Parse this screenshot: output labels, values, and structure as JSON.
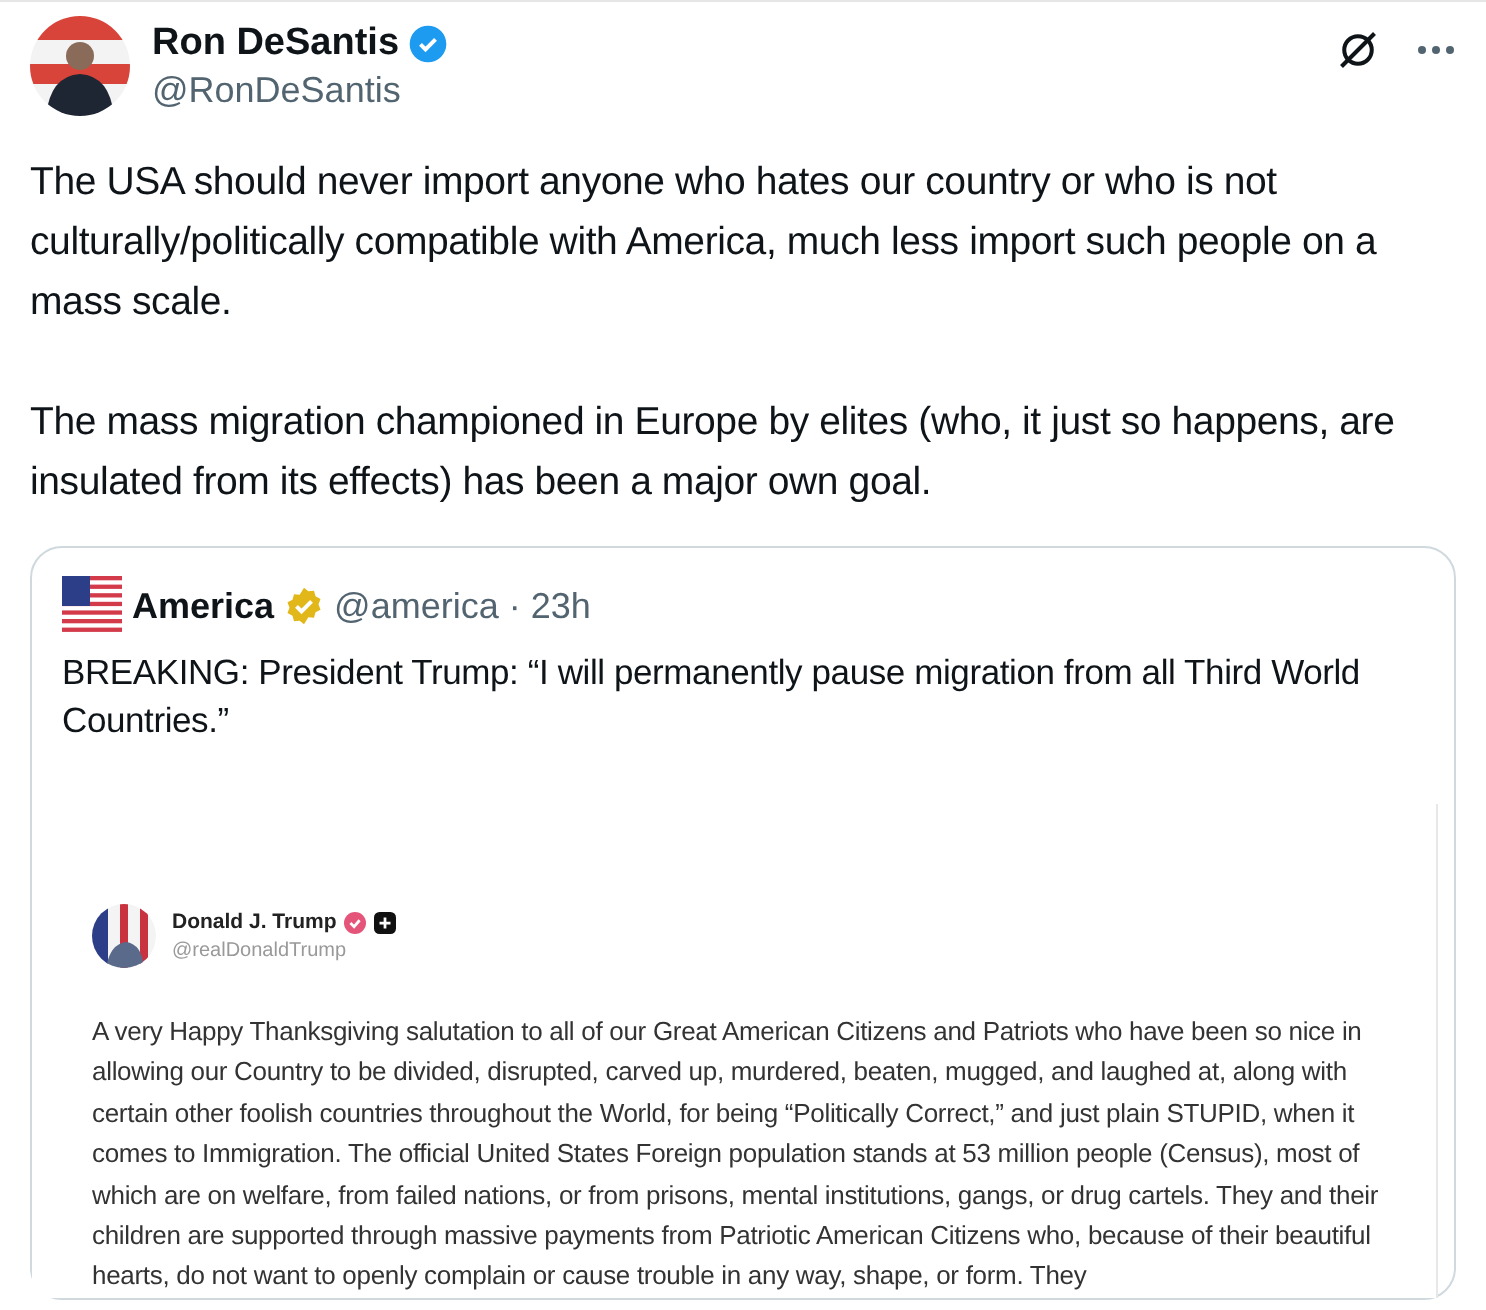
{
  "post": {
    "author": {
      "name": "Ron DeSantis",
      "verified": true,
      "handle": "@RonDeSantis"
    },
    "paragraphs": [
      "The USA should never import anyone who hates our country or who is not culturally/politically compatible with America, much less import such people on a mass scale.",
      "The mass migration championed in Europe by elites (who, it just so happens, are insulated from its effects) has been a major own goal."
    ],
    "quote": {
      "author": {
        "name": "America",
        "verified": true,
        "handle": "@america",
        "separator": "·",
        "time": "23h"
      },
      "text": "BREAKING: President Trump: “I will permanently pause migration from all Third World Countries.”",
      "image": {
        "author": {
          "name": "Donald J. Trump",
          "handle": "@realDonaldTrump"
        },
        "text": "A very Happy Thanksgiving salutation to all of our Great American Citizens and Patriots who have been so nice in allowing our Country to be divided, disrupted, carved up, murdered, beaten, mugged, and laughed at, along with certain other foolish countries throughout the World, for being “Politically Correct,” and just plain STUPID, when it comes to Immigration. The official United States Foreign population stands at 53 million people (Census), most of which are on welfare, from failed nations, or from prisons, mental institutions, gangs, or drug cartels. They and their children are supported through massive payments from Patriotic American Citizens who, because of their beautiful hearts, do not want to openly complain or cause trouble in any way, shape, or form. They"
      }
    }
  }
}
